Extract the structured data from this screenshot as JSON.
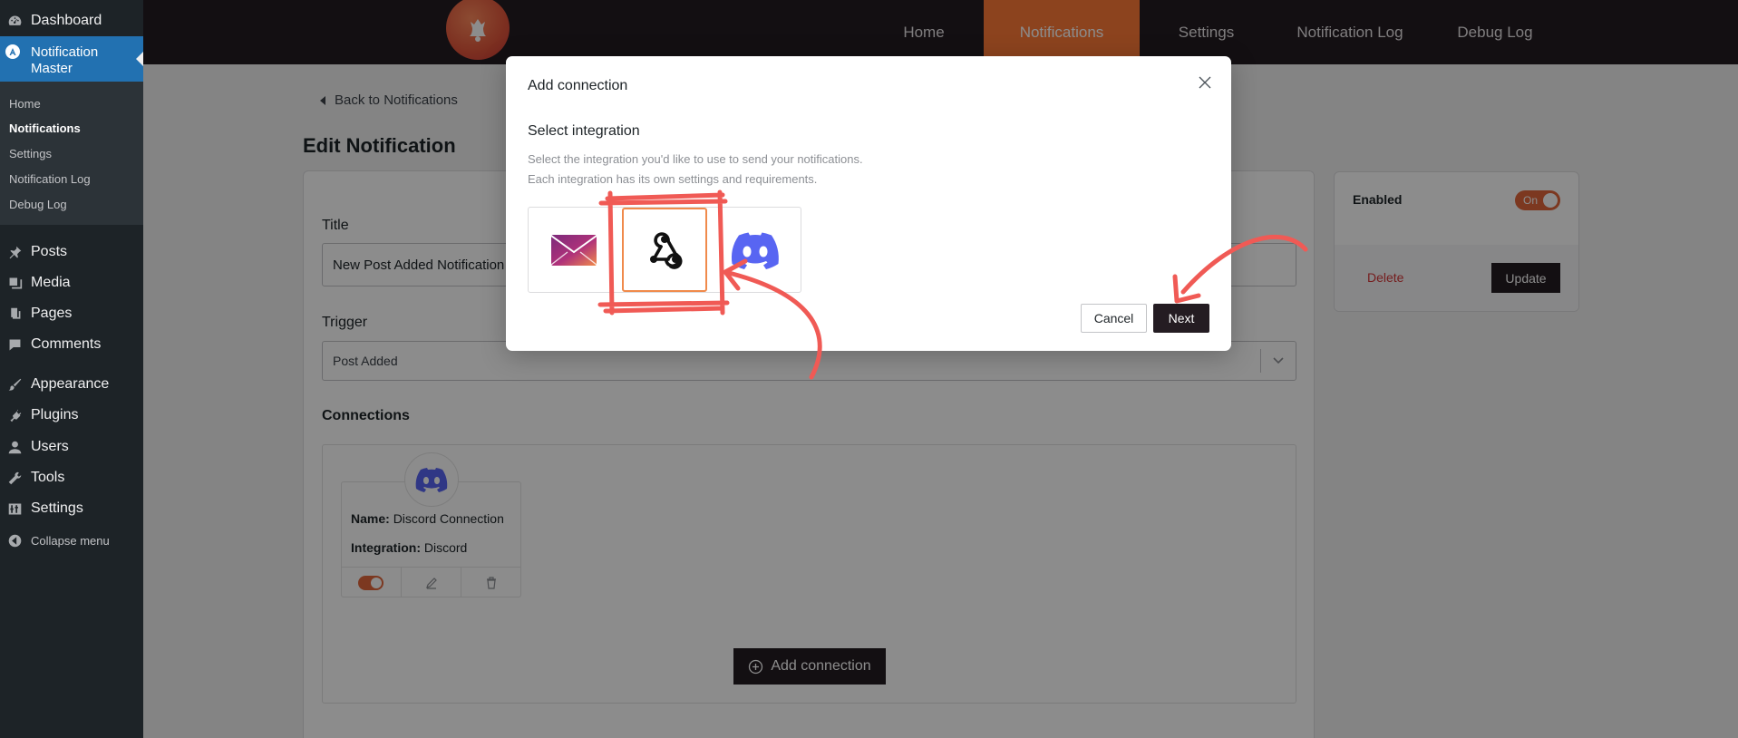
{
  "sidebar": {
    "dashboard": "Dashboard",
    "plugin_title": "Notification Master",
    "sub_items": [
      "Home",
      "Notifications",
      "Settings",
      "Notification Log",
      "Debug Log"
    ],
    "items": [
      "Posts",
      "Media",
      "Pages",
      "Comments",
      "Appearance",
      "Plugins",
      "Users",
      "Tools",
      "Settings"
    ],
    "collapse": "Collapse menu"
  },
  "topnav": {
    "links": [
      "Home",
      "Notifications",
      "Settings",
      "Notification Log",
      "Debug Log"
    ],
    "active": "Notifications",
    "accent": "#ff7a38"
  },
  "page": {
    "back_link": "Back to Notifications",
    "title": "Edit Notification",
    "title_label": "Title",
    "title_value": "New Post Added Notification",
    "trigger_label": "Trigger",
    "trigger_value": "Post Added",
    "connections_label": "Connections",
    "connection": {
      "name_label": "Name:",
      "name_value": "Discord Connection",
      "integration_label": "Integration:",
      "integration_value": "Discord"
    },
    "add_connection": "Add connection"
  },
  "side_panel": {
    "enabled_label": "Enabled",
    "toggle_text": "On",
    "delete": "Delete",
    "update": "Update"
  },
  "modal": {
    "title": "Add connection",
    "heading": "Select integration",
    "desc_line1": "Select the integration you'd like to use to send your notifications.",
    "desc_line2": "Each integration has its own settings and requirements.",
    "integrations": [
      {
        "icon": "email-icon"
      },
      {
        "icon": "webhook-icon",
        "selected": true
      },
      {
        "icon": "discord-icon"
      }
    ],
    "cancel": "Cancel",
    "next": "Next"
  },
  "annotation_color": "#f05a55"
}
